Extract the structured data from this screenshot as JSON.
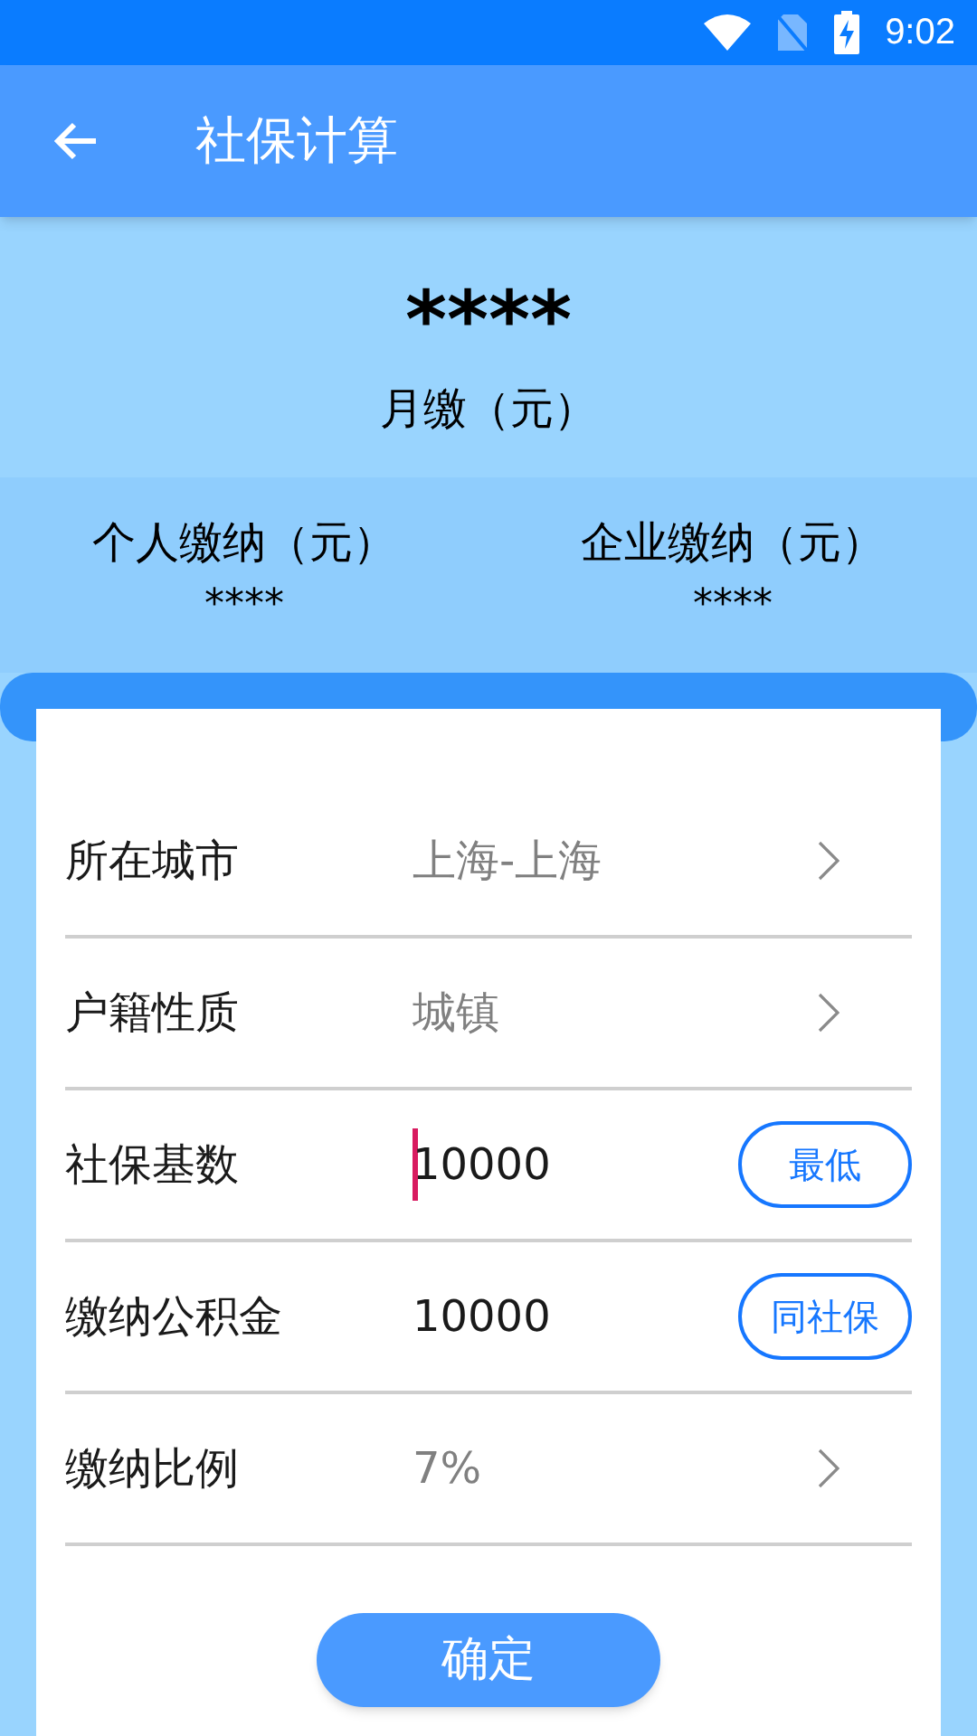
{
  "status_bar": {
    "time": "9:02"
  },
  "app_bar": {
    "title": "社保计算"
  },
  "summary": {
    "amount": "****",
    "label": "月缴（元）"
  },
  "breakdown": [
    {
      "label": "个人缴纳（元）",
      "value": "****"
    },
    {
      "label": "企业缴纳（元）",
      "value": "****"
    }
  ],
  "form": {
    "rows": [
      {
        "kind": "select",
        "label": "所在城市",
        "value": "上海-上海"
      },
      {
        "kind": "select",
        "label": "户籍性质",
        "value": "城镇"
      },
      {
        "kind": "input",
        "label": "社保基数",
        "value": "10000",
        "focused": true,
        "action": "最低"
      },
      {
        "kind": "input",
        "label": "缴纳公积金",
        "value": "10000",
        "focused": false,
        "action": "同社保"
      },
      {
        "kind": "select",
        "label": "缴纳比例",
        "value": "7%"
      }
    ],
    "submit": "确定"
  }
}
